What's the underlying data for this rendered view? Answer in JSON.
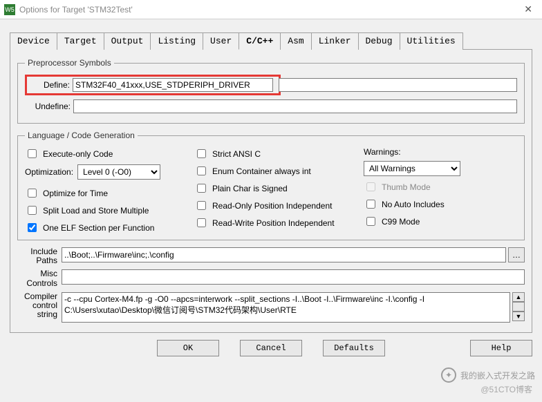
{
  "window": {
    "title": "Options for Target 'STM32Test'",
    "icon_text": "W5"
  },
  "tabs": [
    "Device",
    "Target",
    "Output",
    "Listing",
    "User",
    "C/C++",
    "Asm",
    "Linker",
    "Debug",
    "Utilities"
  ],
  "active_tab": "C/C++",
  "preproc": {
    "legend": "Preprocessor Symbols",
    "define_label": "Define:",
    "define_value": "STM32F40_41xxx,USE_STDPERIPH_DRIVER",
    "undefine_label": "Undefine:",
    "undefine_value": ""
  },
  "lang": {
    "legend": "Language / Code Generation",
    "exec_only": "Execute-only Code",
    "optimization_label": "Optimization:",
    "optimization_value": "Level 0 (-O0)",
    "optimize_time": "Optimize for Time",
    "split_load": "Split Load and Store Multiple",
    "one_elf": "One ELF Section per Function",
    "strict_ansi": "Strict ANSI C",
    "enum_container": "Enum Container always int",
    "plain_char": "Plain Char is Signed",
    "ro_pos": "Read-Only Position Independent",
    "rw_pos": "Read-Write Position Independent",
    "warnings_label": "Warnings:",
    "warnings_value": "All Warnings",
    "thumb_mode": "Thumb Mode",
    "no_auto_inc": "No Auto Includes",
    "c99_mode": "C99 Mode"
  },
  "paths": {
    "include_label": "Include\nPaths",
    "include_value": "..\\Boot;..\\Firmware\\inc;.\\config",
    "misc_label": "Misc\nControls",
    "misc_value": "",
    "compiler_label": "Compiler\ncontrol\nstring",
    "compiler_value": "-c --cpu Cortex-M4.fp -g -O0 --apcs=interwork --split_sections -I..\\Boot -I..\\Firmware\\inc -I.\\config -I C:\\Users\\xutao\\Desktop\\微信订阅号\\STM32代码架构\\User\\RTE"
  },
  "buttons": {
    "ok": "OK",
    "cancel": "Cancel",
    "defaults": "Defaults",
    "help": "Help"
  },
  "watermark": {
    "text": "我的嵌入式开发之路",
    "sub": "@51CTO博客"
  }
}
